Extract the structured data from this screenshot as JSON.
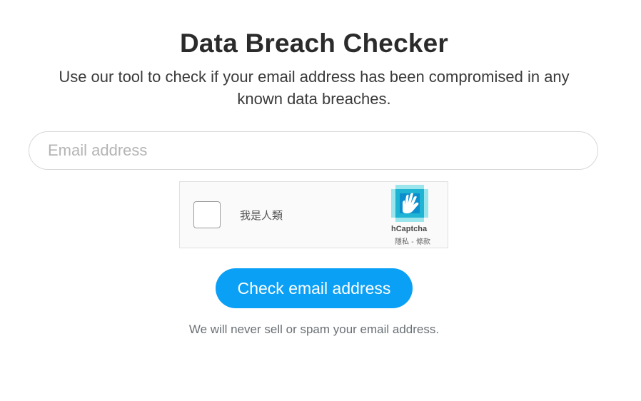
{
  "page": {
    "title": "Data Breach Checker",
    "subtitle": "Use our tool to check if your email address has been compromised in any known data breaches."
  },
  "form": {
    "email_placeholder": "Email address",
    "email_value": "",
    "submit_label": "Check email address",
    "disclaimer": "We will never sell or spam your email address."
  },
  "captcha": {
    "checkbox_label": "我是人類",
    "brand": "hCaptcha",
    "privacy_link": "隱私",
    "separator": " - ",
    "terms_link": "條款",
    "checked": false,
    "logo_icon": "hcaptcha-hand-icon"
  },
  "colors": {
    "button_bg": "#0aa0f5",
    "title": "#2b2b2b",
    "logo_light": "#4dd3e0",
    "logo_dark": "#0074bf"
  }
}
